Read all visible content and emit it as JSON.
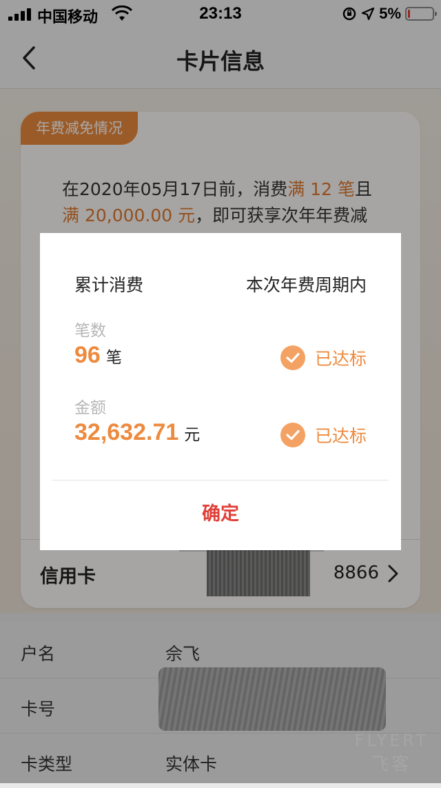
{
  "status_bar": {
    "carrier": "中国移动",
    "time": "23:13",
    "battery_percent": "5%"
  },
  "nav": {
    "title": "卡片信息"
  },
  "card": {
    "tag": "年费减免情况",
    "text_line1_prefix": "在2020年05月17日前，消费",
    "text_line1_hl": "满 12 笔",
    "text_line1_suffix": "且",
    "text_line2_hl": "满 20,000.00 元",
    "text_line2_suffix": "，即可获享次年年费减",
    "row_label": "信用卡",
    "row_number": "8866"
  },
  "info": [
    {
      "key": "户名",
      "value": "佘飞"
    },
    {
      "key": "卡号",
      "value": ""
    },
    {
      "key": "卡类型",
      "value": "实体卡"
    }
  ],
  "watermark": {
    "line1": "FLYERT",
    "line2": "飞客"
  },
  "modal": {
    "header_left": "累计消费",
    "header_right": "本次年费周期内",
    "count": {
      "label": "笔数",
      "value": "96",
      "unit": "笔",
      "status": "已达标"
    },
    "amount": {
      "label": "金额",
      "value": "32,632.71",
      "unit": "元",
      "status": "已达标"
    },
    "confirm_label": "确定"
  },
  "colors": {
    "accent": "#ed8a3e",
    "confirm": "#e0413a",
    "check_bg": "#f4a263"
  }
}
